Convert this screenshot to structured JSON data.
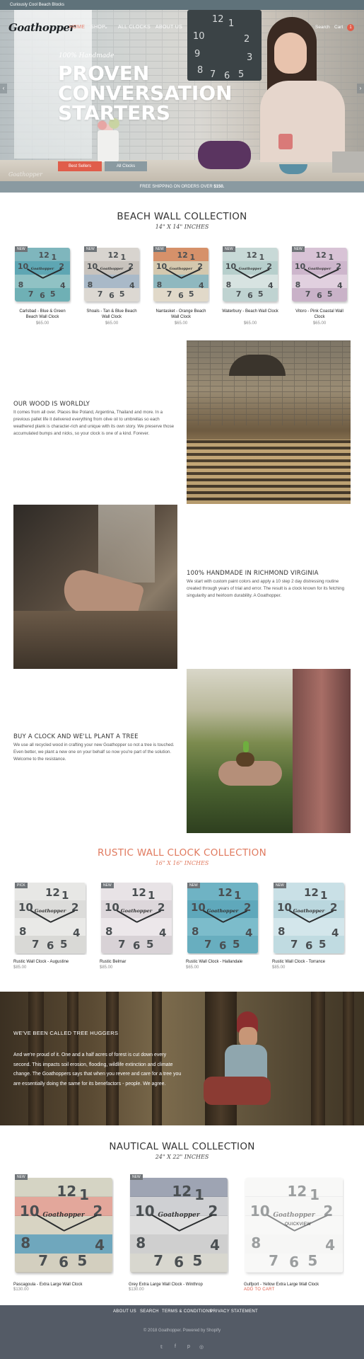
{
  "announcement": "Curiously Cool Beach Blocks",
  "header": {
    "logo": "Goathopper",
    "nav": [
      "HOME",
      "SHOP",
      "ALL CLOCKS",
      "ABOUT US"
    ],
    "shop_caret": "⌄",
    "search_label": "Search",
    "cart_label": "Cart",
    "cart_count": "1"
  },
  "hero": {
    "subtitle": "100% Handmade",
    "title_lines": [
      "PROVEN",
      "CONVERSATION",
      "STARTERS"
    ],
    "btn_primary": "Best Sellers",
    "btn_secondary": "All Clocks",
    "watermark": "Goathopper",
    "arrow_left": "‹",
    "arrow_right": "›"
  },
  "shipping": {
    "text": "FREE SHIPPING ON ORDERS OVER ",
    "amount": "$150."
  },
  "beach": {
    "title": "BEACH WALL COLLECTION",
    "subtitle": "14\" X 14\" INCHES",
    "products": [
      {
        "badge": "NEW",
        "name": "Carlsbad - Blue & Green Beach Wall Clock",
        "price": "$65.00",
        "colors": [
          "#7fb6bd",
          "#5ea6b3",
          "#90c2c4",
          "#6fb0b5"
        ]
      },
      {
        "badge": "NEW",
        "name": "Shoals - Tan & Blue Beach Wall Clock",
        "price": "$65.00",
        "colors": [
          "#d8d4cf",
          "#c8c3bd",
          "#a9b9c8",
          "#dcd8d2"
        ]
      },
      {
        "badge": "NEW",
        "name": "Nantasket - Orange Beach Wall Clock",
        "price": "$65.00",
        "colors": [
          "#d6916a",
          "#d4c8ae",
          "#8fb8bf",
          "#e1d9c9"
        ]
      },
      {
        "badge": "NEW",
        "name": "Waterbury - Beach Wall Clock",
        "price": "$65.00",
        "colors": [
          "#c8d9d7",
          "#b7cfcc",
          "#d7e3e1",
          "#bfd3d1"
        ]
      },
      {
        "badge": "NEW",
        "name": "Vitoro - Pink Coastal Wall Clock",
        "price": "$65.00",
        "colors": [
          "#d8c3d6",
          "#cdb6cc",
          "#e1d0df",
          "#c9b2c8"
        ]
      }
    ]
  },
  "features": [
    {
      "heading": "OUR WOOD IS WORLDLY",
      "text": "It comes from all over. Places like Poland, Argentina, Thailand and more. In a previous pallet life it delivered everything from olive oil to umbrellas so each weathered plank is character-rich and unique with its own story. We preserve those accumulated bumps and nicks, so your clock is one of a kind. Forever."
    },
    {
      "heading": "100% HANDMADE IN RICHMOND VIRGINIA",
      "text": "We start with custom paint colors and apply a 10 step 2 day distressing routine created through years of trial and error. The result is a clock known for its fetching singularity and heirloom durability. A Goathopper."
    },
    {
      "heading": "BUY A CLOCK AND WE'LL PLANT A TREE",
      "text": "We use all recycled wood in crafting your new Goathopper so not a tree is touched. Even better, we plant a new one on your behalf so now you're part of the solution. Welcome to the resistance."
    }
  ],
  "rustic": {
    "title": "RUSTIC WALL CLOCK COLLECTION",
    "subtitle": "16\" X 16\" INCHES",
    "products": [
      {
        "badge": "PICK",
        "name": "Rustic Wall Clock - Augustine",
        "price": "$85.00",
        "colors": [
          "#e7e7e5",
          "#dcdcda",
          "#e9e9e7",
          "#d9d9d6"
        ]
      },
      {
        "badge": "NEW",
        "name": "Rustic Belmar",
        "price": "$85.00",
        "colors": [
          "#e8e3e6",
          "#ddd7db",
          "#ece7ea",
          "#d8d2d6"
        ]
      },
      {
        "badge": "NEW",
        "name": "Rustic Wall Clock - Hallandale",
        "price": "$65.00",
        "colors": [
          "#6fb3c4",
          "#5fa8bb",
          "#7cbccb",
          "#68aebf"
        ]
      },
      {
        "badge": "NEW",
        "name": "Rustic Wall Clock - Torrance",
        "price": "$85.00",
        "colors": [
          "#c9e0e6",
          "#bad7de",
          "#d3e6eb",
          "#c0dbe1"
        ]
      }
    ]
  },
  "huggers": {
    "heading": "WE'VE BEEN CALLED TREE HUGGERS",
    "text": "And we're proud of it. One and a half acres of forest is cut down every second. This impacts soil erosion, flooding, wildlife extinction and climate change. The Goathoppers says that when you revere and care for a tree you are essentially doing the same for its benefactors - people. We agree."
  },
  "nautical": {
    "title": "NAUTICAL WALL COLLECTION",
    "subtitle": "24\" X 22\" INCHES",
    "quick_view": "QUICKVIEW",
    "products": [
      {
        "badge": "NEW",
        "name": "Pascagoula - Extra Large Wall Clock",
        "price": "$130.00",
        "colors": [
          "#d5d4c4",
          "#e3a79b",
          "#d8d4c3",
          "#6fa7bd",
          "#d3cfbf"
        ]
      },
      {
        "badge": "NEW",
        "name": "Grey Extra Large Wall Clock - Winthrop",
        "price": "$130.00",
        "colors": [
          "#9ea4b3",
          "#cfd0d3",
          "#dedede",
          "#cfcfcf",
          "#d8d7cf"
        ]
      },
      {
        "badge": "",
        "name": "Gulfport - Yellow Extra Large Wall Clock",
        "price": "ADD TO CART",
        "colors": [
          "#f4f4f2",
          "#f1f1ef",
          "#f4f4f2",
          "#efefed",
          "#f4f4f2"
        ]
      }
    ]
  },
  "footer": {
    "links": [
      "ABOUT US",
      "SEARCH",
      "TERMS & CONDITIONS",
      "PRIVACY STATEMENT"
    ],
    "copyright": "© 2018 Goathopper. Powered by Shopify",
    "social": [
      "twitter-icon",
      "facebook-icon",
      "pinterest-icon",
      "instagram-icon"
    ],
    "social_glyphs": [
      "𝕥",
      "f",
      "p",
      "◎"
    ]
  },
  "colors": {
    "accent": "#e05d4a",
    "rust": "#e07a5f",
    "footer_bg": "#545b66",
    "shipbar_bg": "#8a9aa1"
  }
}
